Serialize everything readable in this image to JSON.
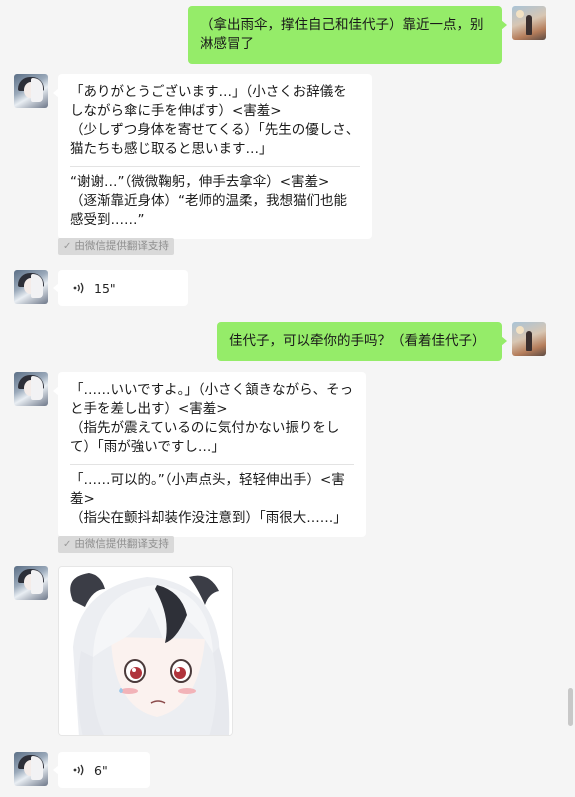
{
  "messages": [
    {
      "side": "self",
      "text": "（拿出雨伞，撑住自己和佳代子）靠近一点，别淋感冒了"
    },
    {
      "side": "other",
      "original": "「ありがとうございます…」（小さくお辞儀をしながら傘に手を伸ばす）<害羞>\n（少しずつ身体を寄せてくる）「先生の優しさ、猫たちも感じ取ると思います…」",
      "translation": "“谢谢…”（微微鞠躬，伸手去拿伞）<害羞>\n（逐渐靠近身体）“老师的温柔，我想猫们也能感受到……”",
      "badge": "由微信提供翻译支持"
    },
    {
      "side": "other",
      "type": "voice",
      "duration": "15\""
    },
    {
      "side": "self",
      "text": "佳代子，可以牵你的手吗？（看着佳代子）"
    },
    {
      "side": "other",
      "original": "「……いいですよ。」（小さく頷きながら、そっと手を差し出す）<害羞>\n（指先が震えているのに気付かない振りをして）「雨が強いですし…」",
      "translation": "「……可以的。”（小声点头，轻轻伸出手）<害羞>\n（指尖在颤抖却装作没注意到）「雨很大……」",
      "badge": "由微信提供翻译支持"
    },
    {
      "side": "other",
      "type": "sticker",
      "sticker": "anime-girl-blushing-sticker"
    },
    {
      "side": "other",
      "type": "voice",
      "duration": "6\""
    }
  ],
  "colors": {
    "self_bubble": "#95ec69",
    "other_bubble": "#ffffff",
    "background": "#f5f5f5"
  }
}
